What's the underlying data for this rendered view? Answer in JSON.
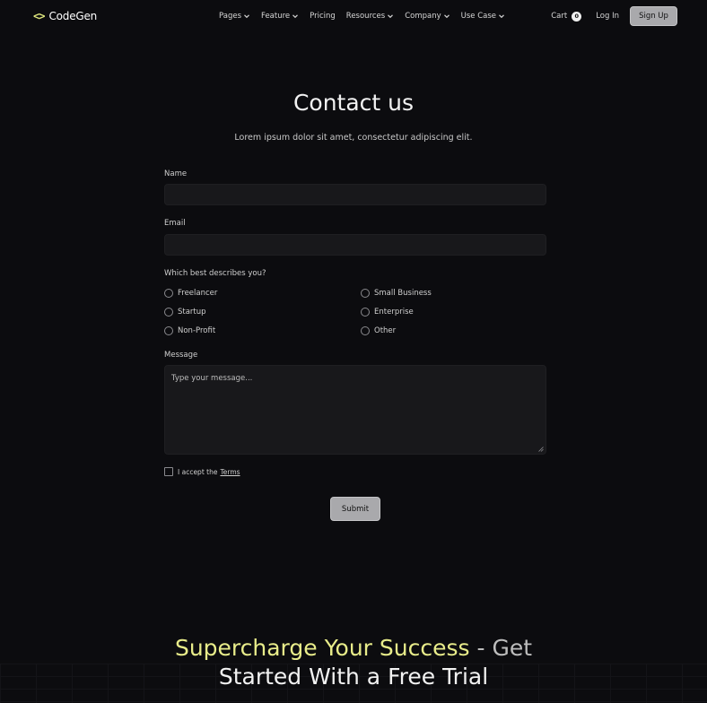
{
  "brand": {
    "name": "CodeGen",
    "icon": "code-brackets-icon",
    "accent": "#e2ea7e"
  },
  "nav": {
    "items": [
      {
        "label": "Pages",
        "dropdown": true
      },
      {
        "label": "Feature",
        "dropdown": true
      },
      {
        "label": "Pricing",
        "dropdown": false
      },
      {
        "label": "Resources",
        "dropdown": true
      },
      {
        "label": "Company",
        "dropdown": true
      },
      {
        "label": "Use Case",
        "dropdown": true
      }
    ],
    "cart_label": "Cart",
    "cart_count": "0",
    "login_label": "Log In",
    "signup_label": "Sign Up"
  },
  "contact": {
    "title": "Contact us",
    "subtitle": "Lorem ipsum dolor sit amet, consectetur adipiscing elit.",
    "name_label": "Name",
    "name_value": "",
    "email_label": "Email",
    "email_value": "",
    "describe_label": "Which best describes you?",
    "options": [
      "Freelancer",
      "Small Business",
      "Startup",
      "Enterprise",
      "Non-Profit",
      "Other"
    ],
    "message_label": "Message",
    "message_placeholder": "Type your message...",
    "terms_prefix": "I accept the",
    "terms_link": "Terms",
    "submit_label": "Submit"
  },
  "cta": {
    "highlight": "Supercharge Your Success",
    "rest": " - Get",
    "line2": "Started With a Free Trial"
  }
}
